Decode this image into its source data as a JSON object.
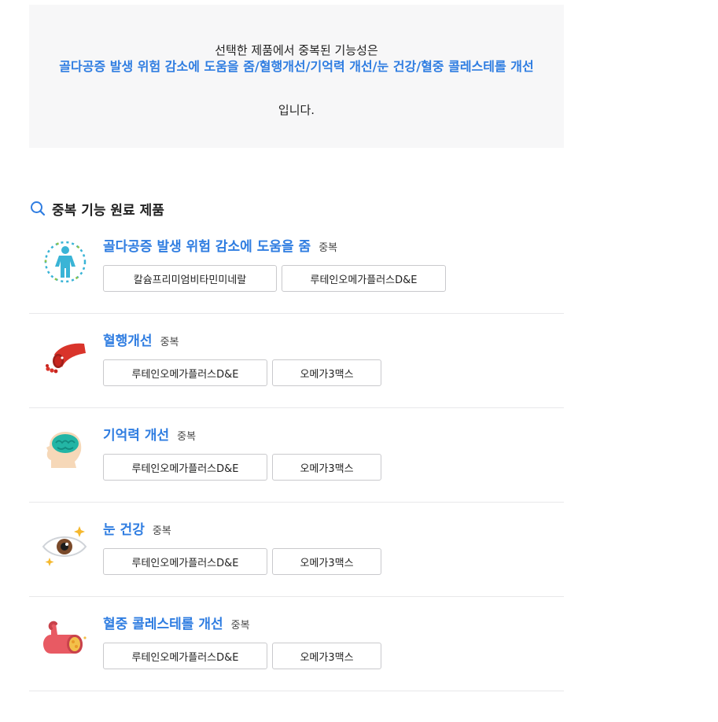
{
  "summary": {
    "line1": "선택한 제품에서 중복된 기능성은",
    "highlight": "골다공증 발생 위험 감소에 도움을 줌/혈행개선/기억력 개선/눈 건강/혈중 콜레스테롤 개선",
    "line3": "입니다."
  },
  "section": {
    "title": "중복 기능 원료 제품",
    "icon": "search-icon"
  },
  "rows": [
    {
      "title": "골다공증 발생 위험 감소에 도움을 줌",
      "tag": "중복",
      "icon": "bone-body-icon",
      "products": [
        "칼슘프리미엄비타민미네랄",
        "루테인오메가플러스D&E"
      ]
    },
    {
      "title": "혈행개선",
      "tag": "중복",
      "icon": "blood-vessel-icon",
      "products": [
        "루테인오메가플러스D&E",
        "오메가3맥스"
      ]
    },
    {
      "title": "기억력 개선",
      "tag": "중복",
      "icon": "brain-head-icon",
      "products": [
        "루테인오메가플러스D&E",
        "오메가3맥스"
      ]
    },
    {
      "title": "눈 건강",
      "tag": "중복",
      "icon": "eye-icon",
      "products": [
        "루테인오메가플러스D&E",
        "오메가3맥스"
      ]
    },
    {
      "title": "혈중 콜레스테롤 개선",
      "tag": "중복",
      "icon": "artery-cholesterol-icon",
      "products": [
        "루테인오메가플러스D&E",
        "오메가3맥스"
      ]
    }
  ]
}
